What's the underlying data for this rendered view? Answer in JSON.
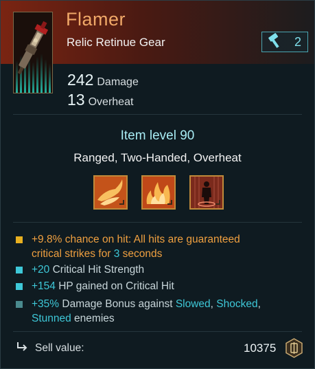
{
  "item": {
    "name": "Flamer",
    "type": "Relic Retinue Gear",
    "tier": "2",
    "tier_icon": "hammer-icon"
  },
  "stats": [
    {
      "value": "242",
      "label": "Damage"
    },
    {
      "value": "13",
      "label": "Overheat"
    }
  ],
  "item_level": "Item level 90",
  "tags": "Ranged, Two-Handed, Overheat",
  "traits": [
    {
      "icon": "flame-sweep-icon"
    },
    {
      "icon": "flames-icon"
    },
    {
      "icon": "burning-figure-icon"
    }
  ],
  "perks": [
    {
      "bullet_color": "#e8b020",
      "lines": [
        [
          {
            "t": "+9.8%",
            "c": "hl-orange"
          },
          {
            "t": " chance on hit: All hits are guaranteed",
            "c": "hl-orange"
          }
        ],
        [
          {
            "t": "critical strikes for ",
            "c": "hl-orange"
          },
          {
            "t": "3",
            "c": "hl-cyan"
          },
          {
            "t": " seconds",
            "c": "hl-orange"
          }
        ]
      ]
    },
    {
      "bullet_color": "#3ec8d8",
      "lines": [
        [
          {
            "t": "+20",
            "c": "hl-cyan"
          },
          {
            "t": " Critical Hit Strength",
            "c": ""
          }
        ]
      ]
    },
    {
      "bullet_color": "#3ec8d8",
      "lines": [
        [
          {
            "t": "+154",
            "c": "hl-cyan"
          },
          {
            "t": " HP gained on Critical Hit",
            "c": ""
          }
        ]
      ]
    },
    {
      "bullet_color": "#4a8a8e",
      "lines": [
        [
          {
            "t": "+35%",
            "c": "hl-cyan"
          },
          {
            "t": " Damage Bonus against ",
            "c": ""
          },
          {
            "t": "Slowed",
            "c": "hl-cyan"
          },
          {
            "t": ", ",
            "c": ""
          },
          {
            "t": "Shocked",
            "c": "hl-cyan"
          },
          {
            "t": ",",
            "c": ""
          }
        ],
        [
          {
            "t": "Stunned",
            "c": "hl-cyan"
          },
          {
            "t": " enemies",
            "c": ""
          }
        ]
      ]
    }
  ],
  "sell": {
    "label": "Sell value:",
    "value": "10375",
    "icon": "sell-arrow-icon",
    "currency_icon": "credits-coin-icon"
  },
  "colors": {
    "header_accent": "#7a2412",
    "name": "#f0a868",
    "cyan": "#3ec8d8",
    "orange": "#f0a040"
  }
}
